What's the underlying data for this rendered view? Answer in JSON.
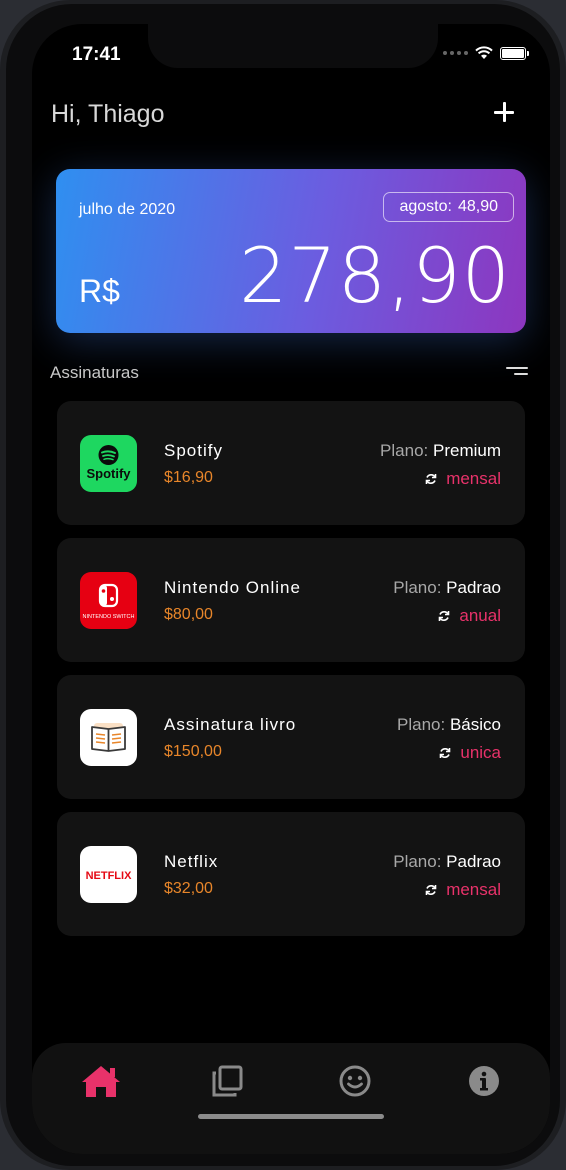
{
  "status_bar": {
    "time": "17:41"
  },
  "header": {
    "greeting": "Hi, Thiago"
  },
  "summary_card": {
    "month": "julho de 2020",
    "next_month_label": "agosto:",
    "next_month_value": "48,90",
    "currency": "R$",
    "total": "278,90"
  },
  "section": {
    "title": "Assinaturas"
  },
  "plan_prefix": "Plano:",
  "subscriptions": [
    {
      "name": "Spotify",
      "price": "$16,90",
      "plan": "Premium",
      "cycle": "mensal",
      "logo_text": "Spotify",
      "logo_color": "#1ed760"
    },
    {
      "name": "Nintendo Online",
      "price": "$80,00",
      "plan": "Padrao",
      "cycle": "anual",
      "logo_text": "NINTENDO SWITCH",
      "logo_color": "#e60012"
    },
    {
      "name": "Assinatura livro",
      "price": "$150,00",
      "plan": "Básico",
      "cycle": "unica",
      "logo_text": "",
      "logo_color": "#ffffff"
    },
    {
      "name": "Netflix",
      "price": "$32,00",
      "plan": "Padrao",
      "cycle": "mensal",
      "logo_text": "NETFLIX",
      "logo_color": "#ffffff"
    }
  ],
  "tabs": [
    {
      "icon": "home-icon",
      "active": true
    },
    {
      "icon": "copy-icon",
      "active": false
    },
    {
      "icon": "smile-icon",
      "active": false
    },
    {
      "icon": "info-icon",
      "active": false
    }
  ],
  "colors": {
    "accent": "#e8326a",
    "price": "#e8862a",
    "tab_active": "#e8326a",
    "tab_inactive": "#8a8a8a"
  }
}
